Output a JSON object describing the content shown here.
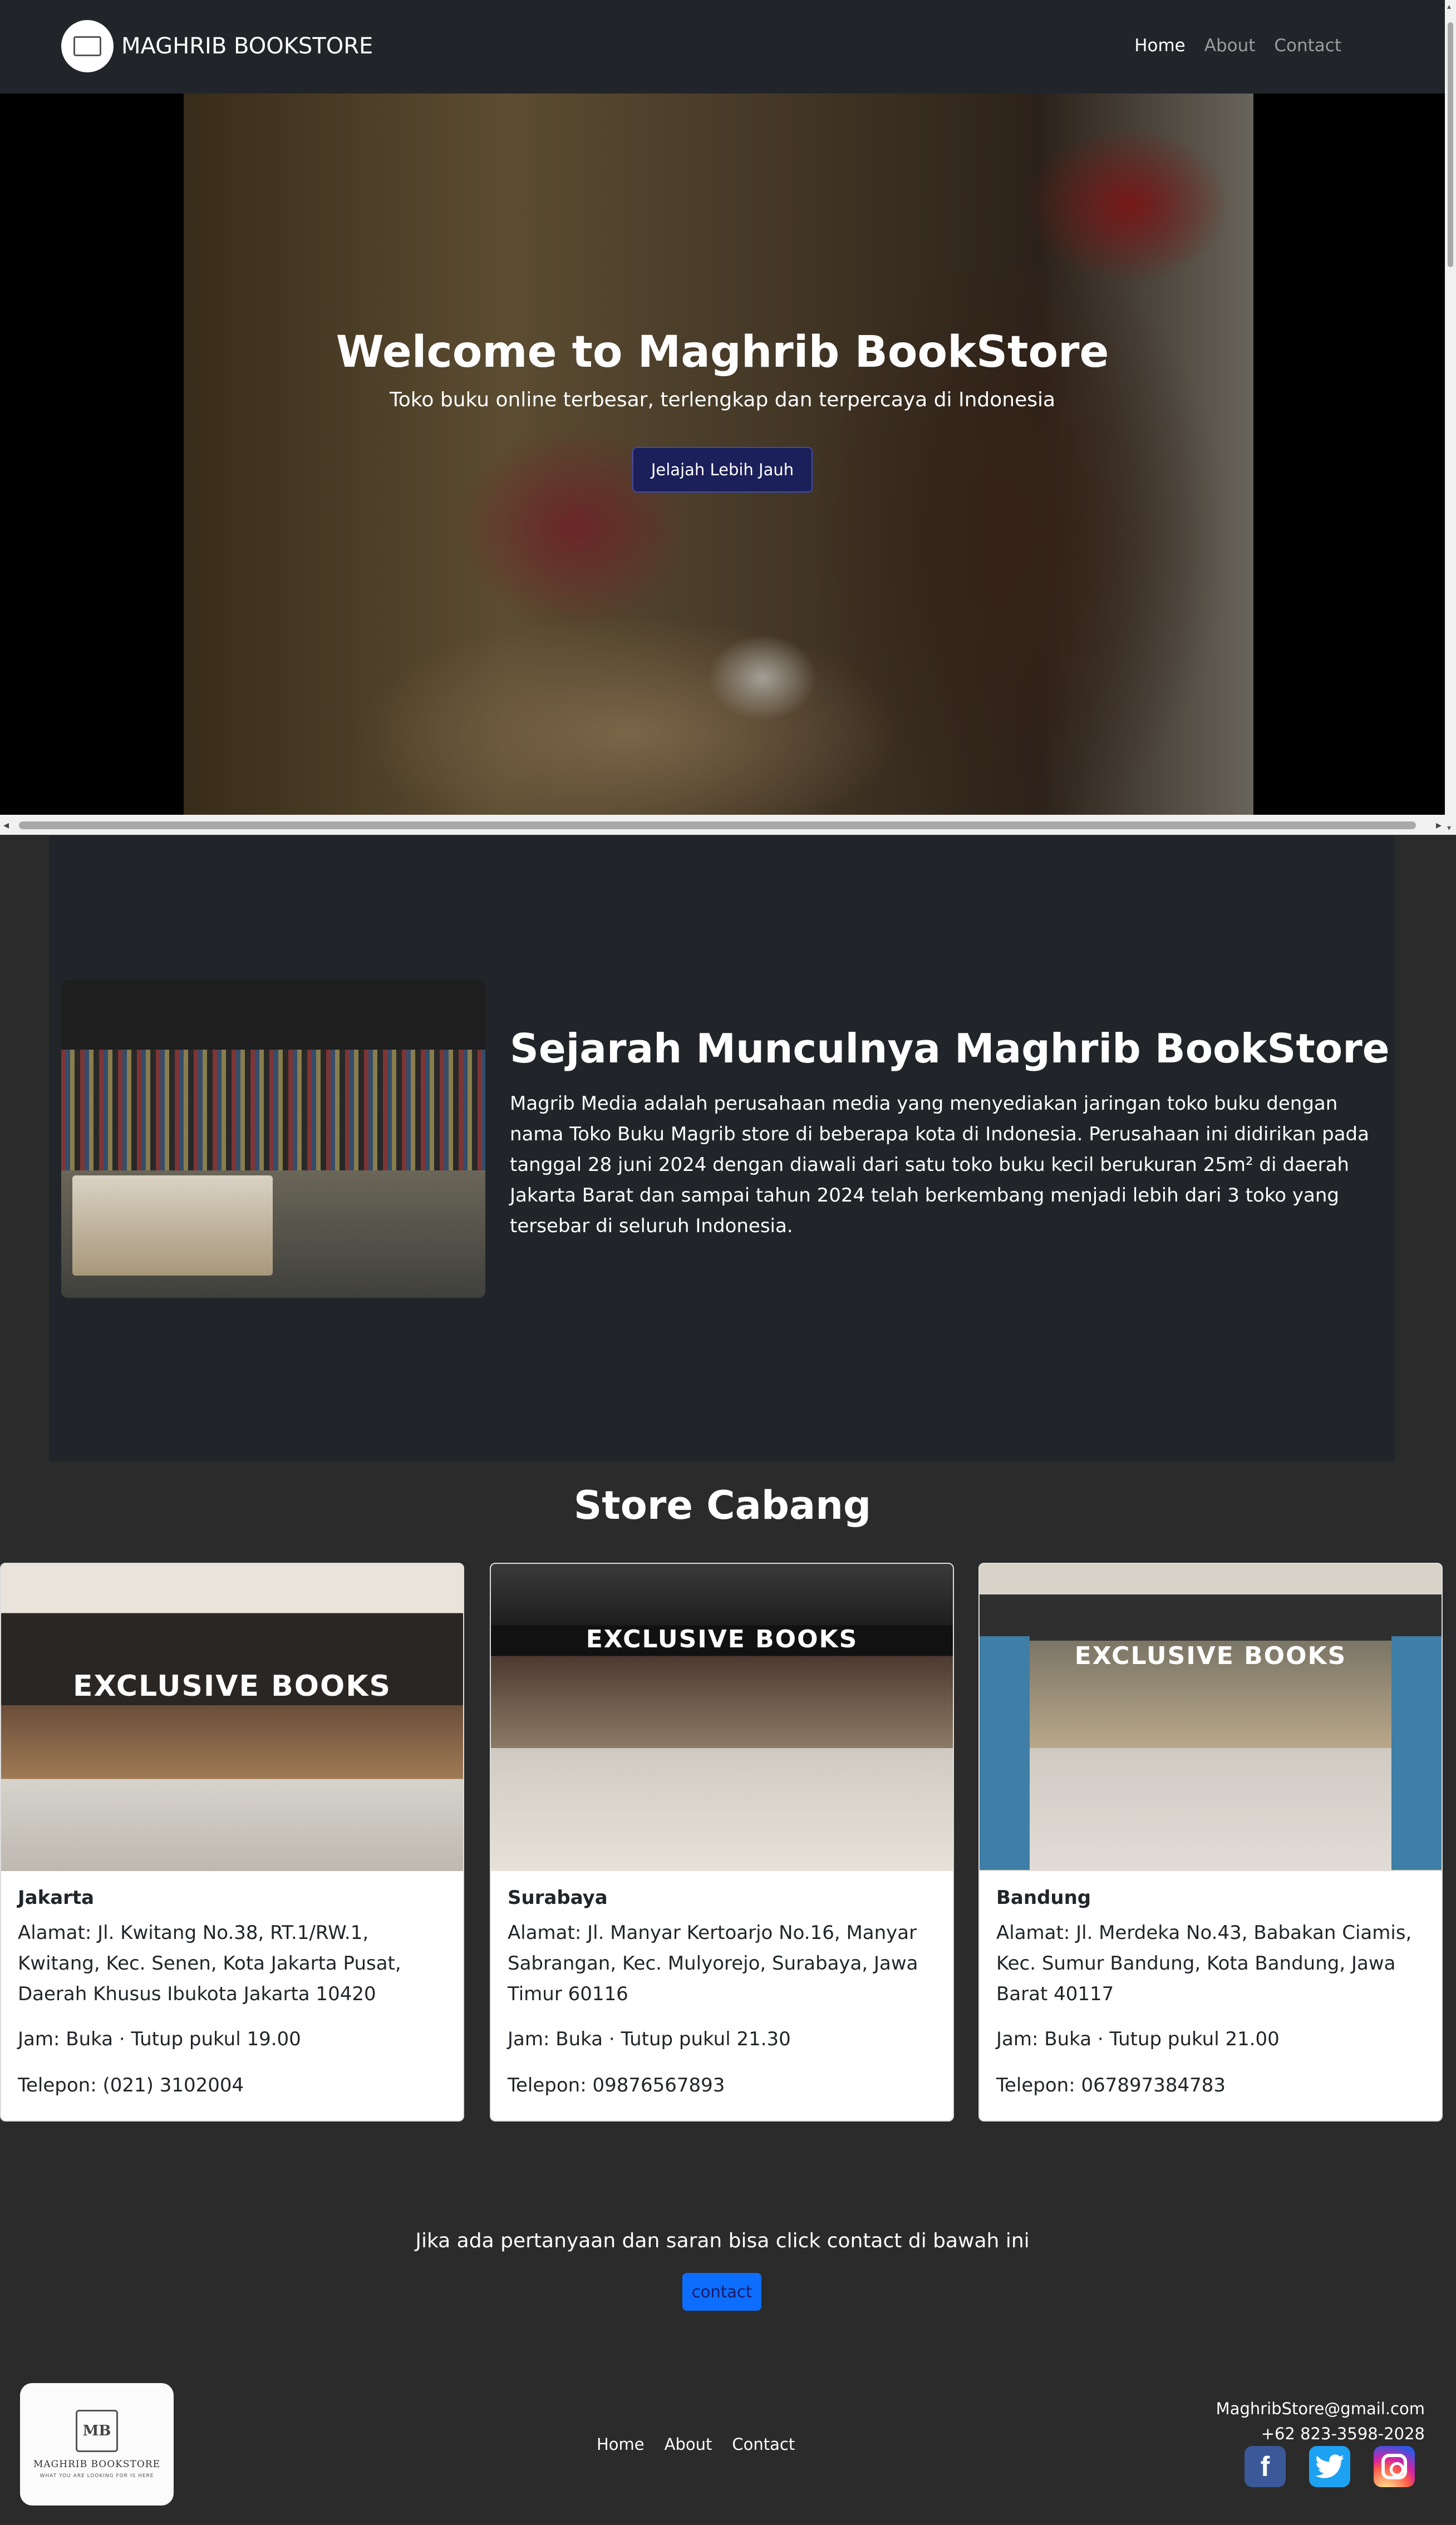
{
  "navbar": {
    "brand": "MAGHRIB BOOKSTORE",
    "links": [
      "Home",
      "About",
      "Contact"
    ]
  },
  "hero": {
    "title": "Welcome to Maghrib BookStore",
    "subtitle": "Toko buku online terbesar, terlengkap dan terpercaya di Indonesia",
    "button": "Jelajah Lebih Jauh"
  },
  "history": {
    "title": "Sejarah Munculnya Maghrib BookStore",
    "text": "Magrib Media adalah perusahaan media yang menyediakan jaringan toko buku dengan nama Toko Buku Magrib store di beberapa kota di Indonesia. Perusahaan ini didirikan pada tanggal 28 juni 2024 dengan diawali dari satu toko buku kecil berukuran 25m² di daerah Jakarta Barat dan sampai tahun 2024 telah berkembang menjadi lebih dari 3 toko yang tersebar di seluruh Indonesia."
  },
  "stores": {
    "title": "Store Cabang",
    "sign_text": "EXCLUSIVE BOOKS",
    "items": [
      {
        "city": "Jakarta",
        "address": "Alamat: Jl. Kwitang No.38, RT.1/RW.1, Kwitang, Kec. Senen, Kota Jakarta Pusat, Daerah Khusus Ibukota Jakarta 10420",
        "hours": "Jam: Buka · Tutup pukul 19.00",
        "phone": "Telepon: (021) 3102004"
      },
      {
        "city": "Surabaya",
        "address": "Alamat: Jl. Manyar Kertoarjo No.16, Manyar Sabrangan, Kec. Mulyorejo, Surabaya, Jawa Timur 60116",
        "hours": "Jam: Buka · Tutup pukul 21.30",
        "phone": "Telepon: 09876567893"
      },
      {
        "city": "Bandung",
        "address": "Alamat: Jl. Merdeka No.43, Babakan Ciamis, Kec. Sumur Bandung, Kota Bandung, Jawa Barat 40117",
        "hours": "Jam: Buka · Tutup pukul 21.00",
        "phone": "Telepon: 067897384783"
      }
    ]
  },
  "contact_section": {
    "text": "Jika ada pertanyaan dan saran bisa click contact di bawah ini",
    "button": "contact"
  },
  "footer": {
    "logo_name": "MAGHRIB BOOKSTORE",
    "logo_tagline": "WHAT YOU ARE LOOKING FOR IS HERE",
    "links": [
      "Home",
      "About",
      "Contact"
    ],
    "email": "MaghribStore@gmail.com",
    "phone": "+62 823-3598-2028",
    "social_icons": [
      "facebook-icon",
      "twitter-icon",
      "instagram-icon"
    ]
  }
}
